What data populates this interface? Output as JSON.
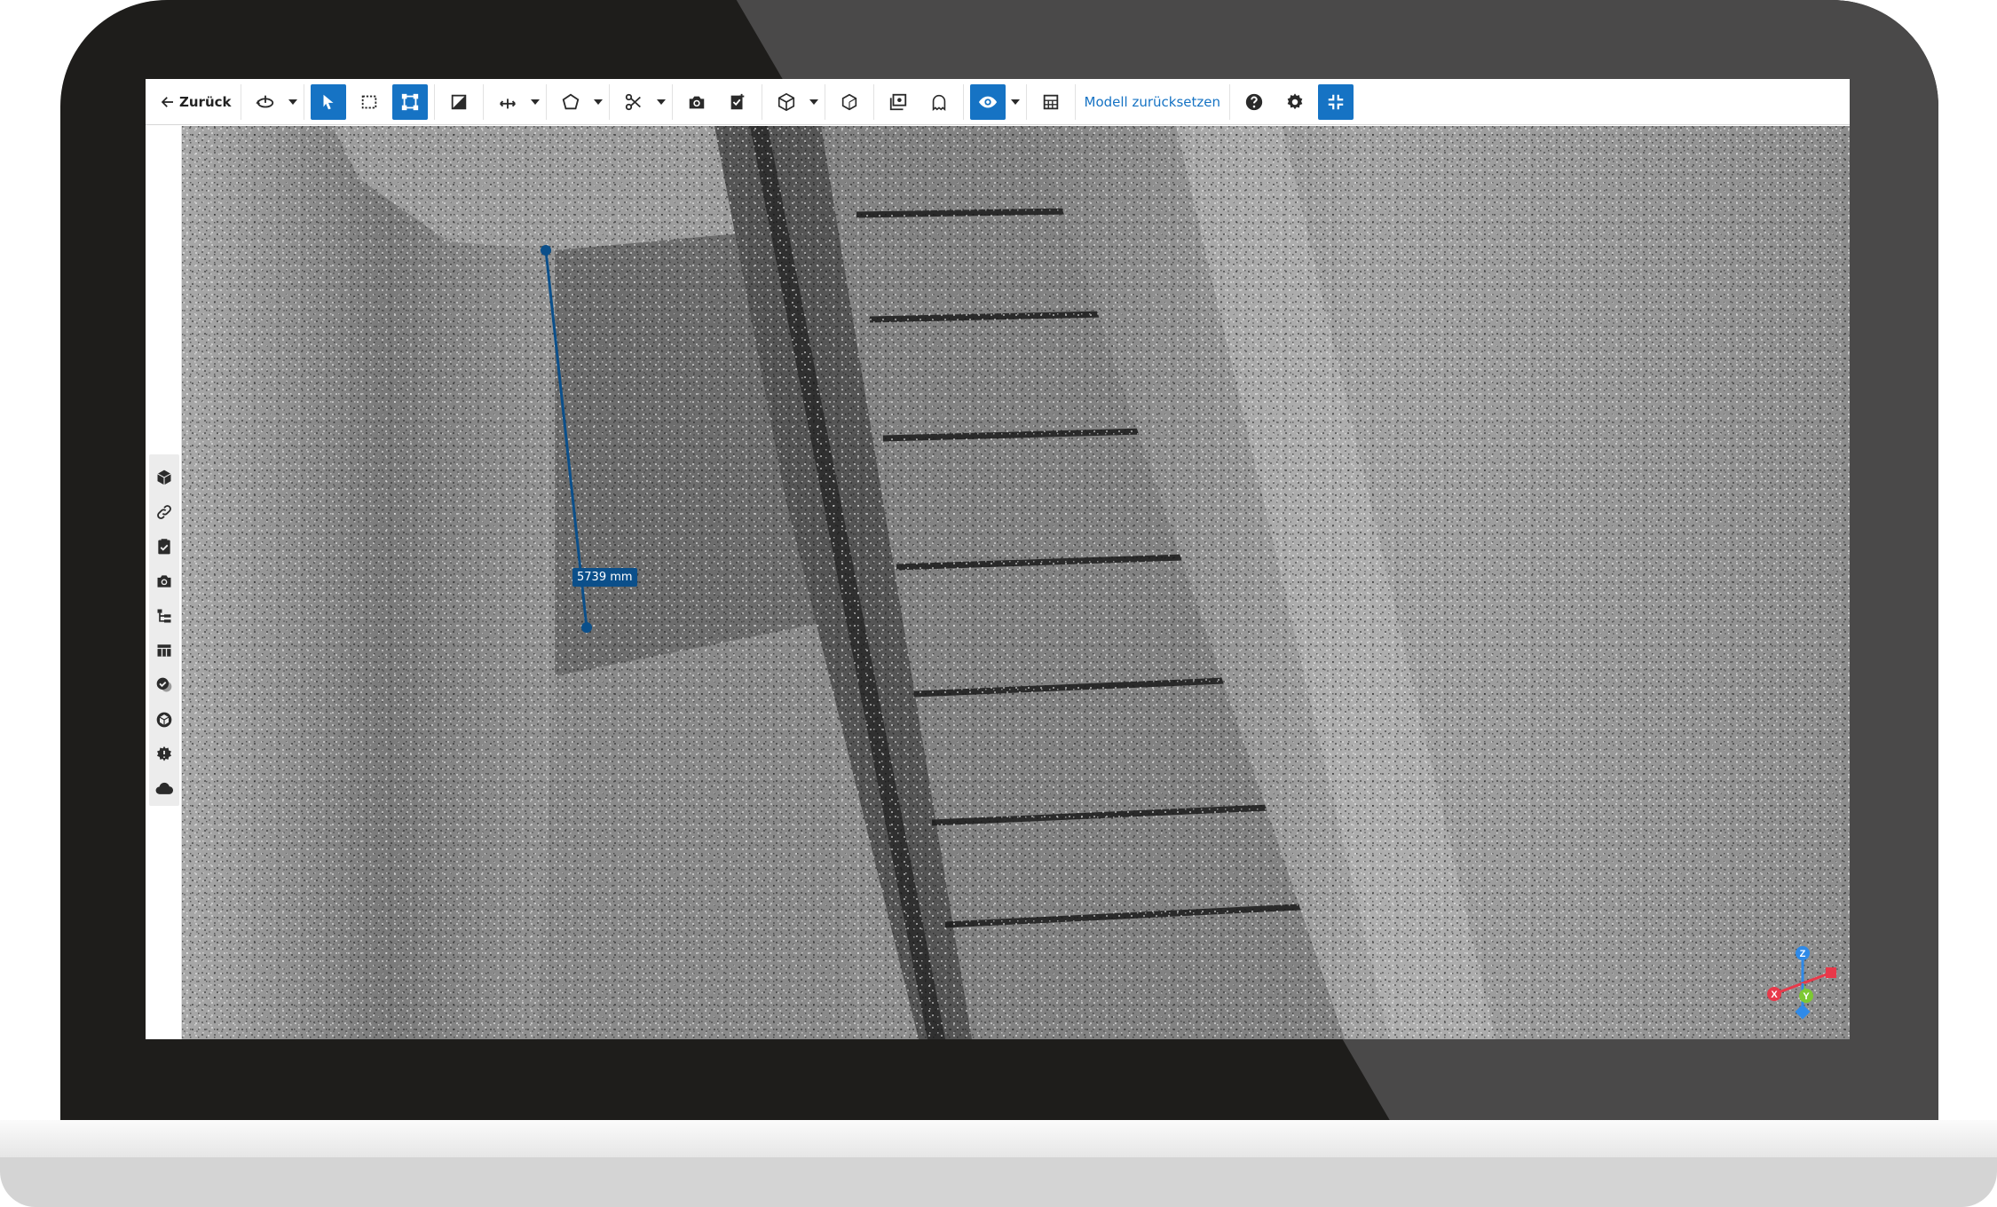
{
  "toolbar": {
    "back_label": "Zurück",
    "reset_model_label": "Modell zurücksetzen",
    "buttons": [
      {
        "icon": "orbit-icon",
        "caret": true
      },
      {
        "icon": "pointer-icon",
        "active": true
      },
      {
        "icon": "box-select-icon"
      },
      {
        "icon": "bounding-box-icon",
        "active": true
      },
      {
        "icon": "shading-icon"
      },
      {
        "icon": "measure-axis-icon",
        "caret": true
      },
      {
        "icon": "polygon-icon",
        "caret": true
      },
      {
        "icon": "scissors-icon",
        "caret": true
      },
      {
        "icon": "camera-add-icon"
      },
      {
        "icon": "clipboard-add-icon"
      },
      {
        "icon": "cube-icon",
        "caret": true
      },
      {
        "icon": "cube-outline-icon"
      },
      {
        "icon": "image-stack-icon"
      },
      {
        "icon": "ghost-icon"
      },
      {
        "icon": "eye-icon",
        "active": true,
        "caret": true
      },
      {
        "icon": "grid-calculator-icon"
      },
      {
        "icon": "help-icon"
      },
      {
        "icon": "gear-icon"
      },
      {
        "icon": "compress-icon",
        "active": true
      }
    ]
  },
  "sidebar": {
    "items": [
      {
        "icon": "cube-icon"
      },
      {
        "icon": "link-icon"
      },
      {
        "icon": "clipboard-check-icon"
      },
      {
        "icon": "camera-icon"
      },
      {
        "icon": "tree-list-icon"
      },
      {
        "icon": "table-icon"
      },
      {
        "icon": "layers-check-icon"
      },
      {
        "icon": "cubes-icon"
      },
      {
        "icon": "gear-badge-icon"
      },
      {
        "icon": "cloud-icon"
      }
    ]
  },
  "viewport": {
    "measurement_label": "5739 mm",
    "axes": {
      "x": "X",
      "y": "Y",
      "z": "Z"
    }
  },
  "colors": {
    "accent": "#1673c4",
    "measurement": "#0b4f8a",
    "axis_x": "#e8394a",
    "axis_y": "#7dc832",
    "axis_z": "#2f8ae8"
  }
}
